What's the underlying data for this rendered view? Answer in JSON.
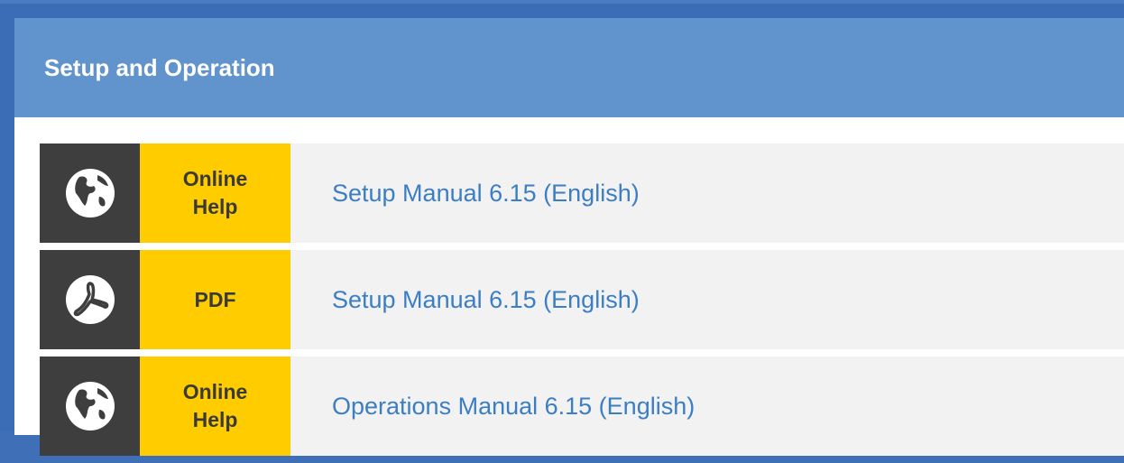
{
  "panel": {
    "title": "Setup and Operation"
  },
  "rows": [
    {
      "icon": "globe-icon",
      "badge": "Online\nHelp",
      "link": "Setup Manual 6.15 (English)"
    },
    {
      "icon": "pdf-icon",
      "badge": "PDF",
      "link": "Setup Manual 6.15 (English)"
    },
    {
      "icon": "globe-icon",
      "badge": "Online\nHelp",
      "link": "Operations Manual 6.15 (English)"
    }
  ],
  "colors": {
    "header": "#6193cc",
    "badge": "#ffcc00",
    "icon_bg": "#3e3e3e",
    "link": "#3c7ec4",
    "row_bg": "#f2f2f2"
  }
}
